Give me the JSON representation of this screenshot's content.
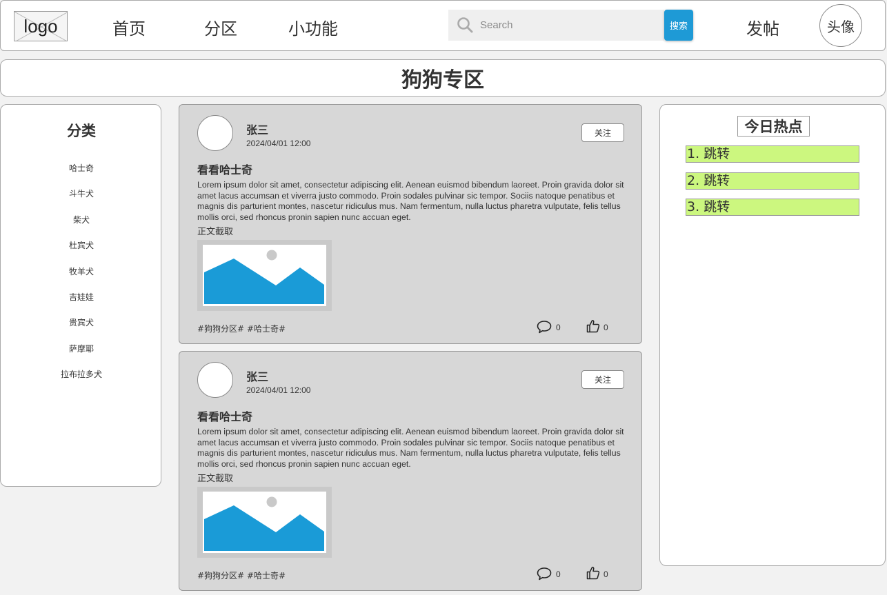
{
  "header": {
    "logo_text": "logo",
    "nav": [
      "首页",
      "分区",
      "小功能"
    ],
    "search_placeholder": "Search",
    "search_button": "搜索",
    "post_link": "发帖",
    "avatar_label": "头像"
  },
  "page_title": "狗狗专区",
  "sidebar": {
    "title": "分类",
    "items": [
      "哈士奇",
      "斗牛犬",
      "柴犬",
      "杜宾犬",
      "牧羊犬",
      "吉娃娃",
      "贵宾犬",
      "萨摩耶",
      "拉布拉多犬"
    ]
  },
  "posts": [
    {
      "author": "张三",
      "time": "2024/04/01 12:00",
      "follow_label": "关注",
      "title": "看看哈士奇",
      "body": "Lorem ipsum dolor sit amet, consectetur adipiscing elit. Aenean euismod bibendum laoreet. Proin gravida dolor sit amet lacus accumsan et viverra justo commodo. Proin sodales pulvinar sic tempor. Sociis natoque penatibus et magnis dis parturient montes, nascetur ridiculus mus. Nam fermentum, nulla luctus pharetra vulputate, felis tellus mollis orci, sed rhoncus pronin sapien nunc accuan eget.",
      "excerpt_label": "正文截取",
      "tags": "#狗狗分区# #哈士奇#",
      "comments": "0",
      "likes": "0"
    },
    {
      "author": "张三",
      "time": "2024/04/01 12:00",
      "follow_label": "关注",
      "title": "看看哈士奇",
      "body": "Lorem ipsum dolor sit amet, consectetur adipiscing elit. Aenean euismod bibendum laoreet. Proin gravida dolor sit amet lacus accumsan et viverra justo commodo. Proin sodales pulvinar sic tempor. Sociis natoque penatibus et magnis dis parturient montes, nascetur ridiculus mus. Nam fermentum, nulla luctus pharetra vulputate, felis tellus mollis orci, sed rhoncus pronin sapien nunc accuan eget.",
      "excerpt_label": "正文截取",
      "tags": "#狗狗分区# #哈士奇#",
      "comments": "0",
      "likes": "0"
    }
  ],
  "hot": {
    "title": "今日热点",
    "items": [
      "1. 跳转",
      "2. 跳转",
      "3. 跳转"
    ]
  },
  "colors": {
    "accent": "#1e9ad6",
    "hot_item_bg": "#ccf77f",
    "post_bg": "#d7d7d7",
    "image_blue": "#1a9bd7"
  },
  "icons": [
    "search-icon",
    "comment-icon",
    "like-icon",
    "image-placeholder-icon"
  ]
}
